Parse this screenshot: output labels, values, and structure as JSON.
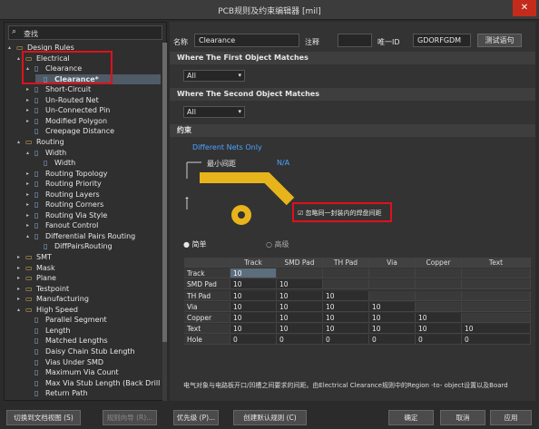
{
  "window": {
    "title": "PCB规则及约束编辑器 [mil]",
    "close": "✕"
  },
  "search": {
    "placeholder": "查找",
    "icon": "search-icon"
  },
  "tree": [
    {
      "label": "Design Rules",
      "icon": "folder",
      "ex": "▴"
    },
    {
      "label": "Electrical",
      "icon": "folder",
      "ex": "▴"
    },
    {
      "label": "Clearance",
      "icon": "rule",
      "ex": "▴"
    },
    {
      "label": "Clearance*",
      "icon": "rule-item",
      "ex": ""
    },
    {
      "label": "Short-Circuit",
      "icon": "rule",
      "ex": "▸"
    },
    {
      "label": "Un-Routed Net",
      "icon": "rule",
      "ex": "▸"
    },
    {
      "label": "Un-Connected Pin",
      "icon": "rule",
      "ex": "▸"
    },
    {
      "label": "Modified Polygon",
      "icon": "rule",
      "ex": "▸"
    },
    {
      "label": "Creepage Distance",
      "icon": "rule",
      "ex": ""
    },
    {
      "label": "Routing",
      "icon": "folder",
      "ex": "▴"
    },
    {
      "label": "Width",
      "icon": "rule",
      "ex": "▴"
    },
    {
      "label": "Width",
      "icon": "rule-item",
      "ex": ""
    },
    {
      "label": "Routing Topology",
      "icon": "rule",
      "ex": "▸"
    },
    {
      "label": "Routing Priority",
      "icon": "rule",
      "ex": "▸"
    },
    {
      "label": "Routing Layers",
      "icon": "rule",
      "ex": "▸"
    },
    {
      "label": "Routing Corners",
      "icon": "rule",
      "ex": "▸"
    },
    {
      "label": "Routing Via Style",
      "icon": "rule",
      "ex": "▸"
    },
    {
      "label": "Fanout Control",
      "icon": "rule",
      "ex": "▸"
    },
    {
      "label": "Differential Pairs Routing",
      "icon": "rule",
      "ex": "▴"
    },
    {
      "label": "DiffPairsRouting",
      "icon": "rule-item",
      "ex": ""
    },
    {
      "label": "SMT",
      "icon": "folder",
      "ex": "▸"
    },
    {
      "label": "Mask",
      "icon": "folder",
      "ex": "▸"
    },
    {
      "label": "Plane",
      "icon": "folder",
      "ex": "▸"
    },
    {
      "label": "Testpoint",
      "icon": "folder",
      "ex": "▸"
    },
    {
      "label": "Manufacturing",
      "icon": "folder",
      "ex": "▸"
    },
    {
      "label": "High Speed",
      "icon": "folder",
      "ex": "▴"
    },
    {
      "label": "Parallel Segment",
      "icon": "rule",
      "ex": ""
    },
    {
      "label": "Length",
      "icon": "rule",
      "ex": ""
    },
    {
      "label": "Matched Lengths",
      "icon": "rule",
      "ex": ""
    },
    {
      "label": "Daisy Chain Stub Length",
      "icon": "rule",
      "ex": ""
    },
    {
      "label": "Vias Under SMD",
      "icon": "rule",
      "ex": ""
    },
    {
      "label": "Maximum Via Count",
      "icon": "rule",
      "ex": ""
    },
    {
      "label": "Max Via Stub Length (Back Drilling)",
      "icon": "rule",
      "ex": ""
    },
    {
      "label": "Return Path",
      "icon": "rule",
      "ex": ""
    }
  ],
  "form": {
    "name_label": "名称",
    "name_value": "Clearance",
    "comment_label": "注释",
    "comment_value": "",
    "uid_label": "唯一ID",
    "uid_value": "GDORFGDM",
    "test_button": "测试语句"
  },
  "first_match": {
    "header": "Where The First Object Matches",
    "value": "All"
  },
  "second_match": {
    "header": "Where The Second Object Matches",
    "value": "All"
  },
  "constraints": {
    "header": "约束",
    "net_scope": "Different Nets Only",
    "min_clearance_label": "最小间距",
    "min_clearance_value": "N/A",
    "ignore_pads_label": "忽略同一封装内的焊盘间距",
    "ignore_pads_checked": true,
    "mode_simple": "简单",
    "mode_advanced": "高级",
    "mode_selected": "simple"
  },
  "matrix": {
    "columns": [
      "",
      "Track",
      "SMD Pad",
      "TH Pad",
      "Via",
      "Copper",
      "Text"
    ],
    "rows": [
      {
        "label": "Track",
        "cells": [
          "10",
          "",
          "",
          "",
          "",
          ""
        ]
      },
      {
        "label": "SMD Pad",
        "cells": [
          "10",
          "10",
          "",
          "",
          "",
          ""
        ]
      },
      {
        "label": "TH Pad",
        "cells": [
          "10",
          "10",
          "10",
          "",
          "",
          ""
        ]
      },
      {
        "label": "Via",
        "cells": [
          "10",
          "10",
          "10",
          "10",
          "",
          ""
        ]
      },
      {
        "label": "Copper",
        "cells": [
          "10",
          "10",
          "10",
          "10",
          "10",
          ""
        ]
      },
      {
        "label": "Text",
        "cells": [
          "10",
          "10",
          "10",
          "10",
          "10",
          "10"
        ]
      },
      {
        "label": "Hole",
        "cells": [
          "0",
          "0",
          "0",
          "0",
          "0",
          "0"
        ]
      }
    ]
  },
  "footnote": "电气对象与电路板开口/凹槽之间要求的间距。由Electrical Clearance规则中的Region -to- object设置以及Board",
  "buttons": {
    "switch_view": "切换到文档视图 (S)",
    "rule_wizard": "规则向导 (R)...",
    "priority": "优先级 (P)...",
    "create_default": "创建默认规则 (C)",
    "ok": "确定",
    "cancel": "取消",
    "apply": "应用"
  },
  "colors": {
    "accent": "#2f8fd8",
    "trace": "#e8b41c",
    "highlight": "#e0101a",
    "selection": "#4f5b66"
  }
}
